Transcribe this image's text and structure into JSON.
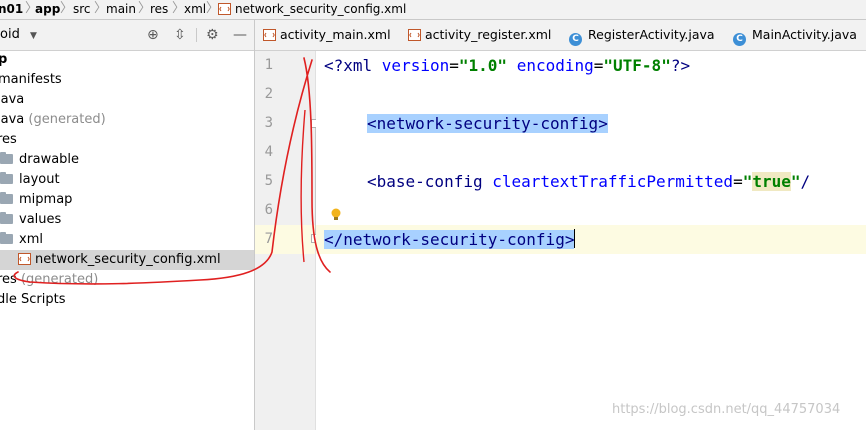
{
  "breadcrumb": {
    "items": [
      "n01",
      "app",
      "src",
      "main",
      "res",
      "xml",
      "network_security_config.xml"
    ]
  },
  "project_panel": {
    "title": "oid",
    "tree": [
      {
        "label": "p",
        "muted": ""
      },
      {
        "label": "manifests",
        "muted": ""
      },
      {
        "label": "java",
        "muted": ""
      },
      {
        "label": "java",
        "muted": "(generated)"
      },
      {
        "label": "res",
        "muted": ""
      },
      {
        "label": "drawable",
        "muted": ""
      },
      {
        "label": "layout",
        "muted": ""
      },
      {
        "label": "mipmap",
        "muted": ""
      },
      {
        "label": "values",
        "muted": ""
      },
      {
        "label": "xml",
        "muted": ""
      },
      {
        "label": "network_security_config.xml",
        "muted": ""
      },
      {
        "label": "res",
        "muted": "(generated)"
      },
      {
        "label": "dle Scripts",
        "muted": ""
      }
    ]
  },
  "tabs": [
    {
      "label": "activity_main.xml",
      "icon": "xml-file-icon"
    },
    {
      "label": "activity_register.xml",
      "icon": "xml-file-icon"
    },
    {
      "label": "RegisterActivity.java",
      "icon": "java-class-icon"
    },
    {
      "label": "MainActivity.java",
      "icon": "java-class-icon"
    }
  ],
  "editor": {
    "line_numbers": [
      "1",
      "2",
      "3",
      "4",
      "5",
      "6",
      "7"
    ],
    "line1": {
      "open": "<?xml ",
      "attr1": "version",
      "eq1": "=",
      "val1": "\"1.0\"",
      "sp": " ",
      "attr2": "encoding",
      "eq2": "=",
      "val2": "\"UTF-8\"",
      "close": "?>"
    },
    "line3": {
      "tag": "<network-security-config>"
    },
    "line5": {
      "open": "<base-config ",
      "attr": "cleartextTrafficPermitted",
      "eq": "=",
      "q1": "\"",
      "val": "true",
      "q2": "\"",
      "rest": "/"
    },
    "line7": {
      "tag": "</network-security-config>"
    }
  },
  "watermark": "https://blog.csdn.net/qq_44757034",
  "colors": {
    "tag": "#000080",
    "attr": "#0000ff",
    "value": "#008000",
    "highlight": "#a8d1ff",
    "annotation": "#e02020"
  }
}
